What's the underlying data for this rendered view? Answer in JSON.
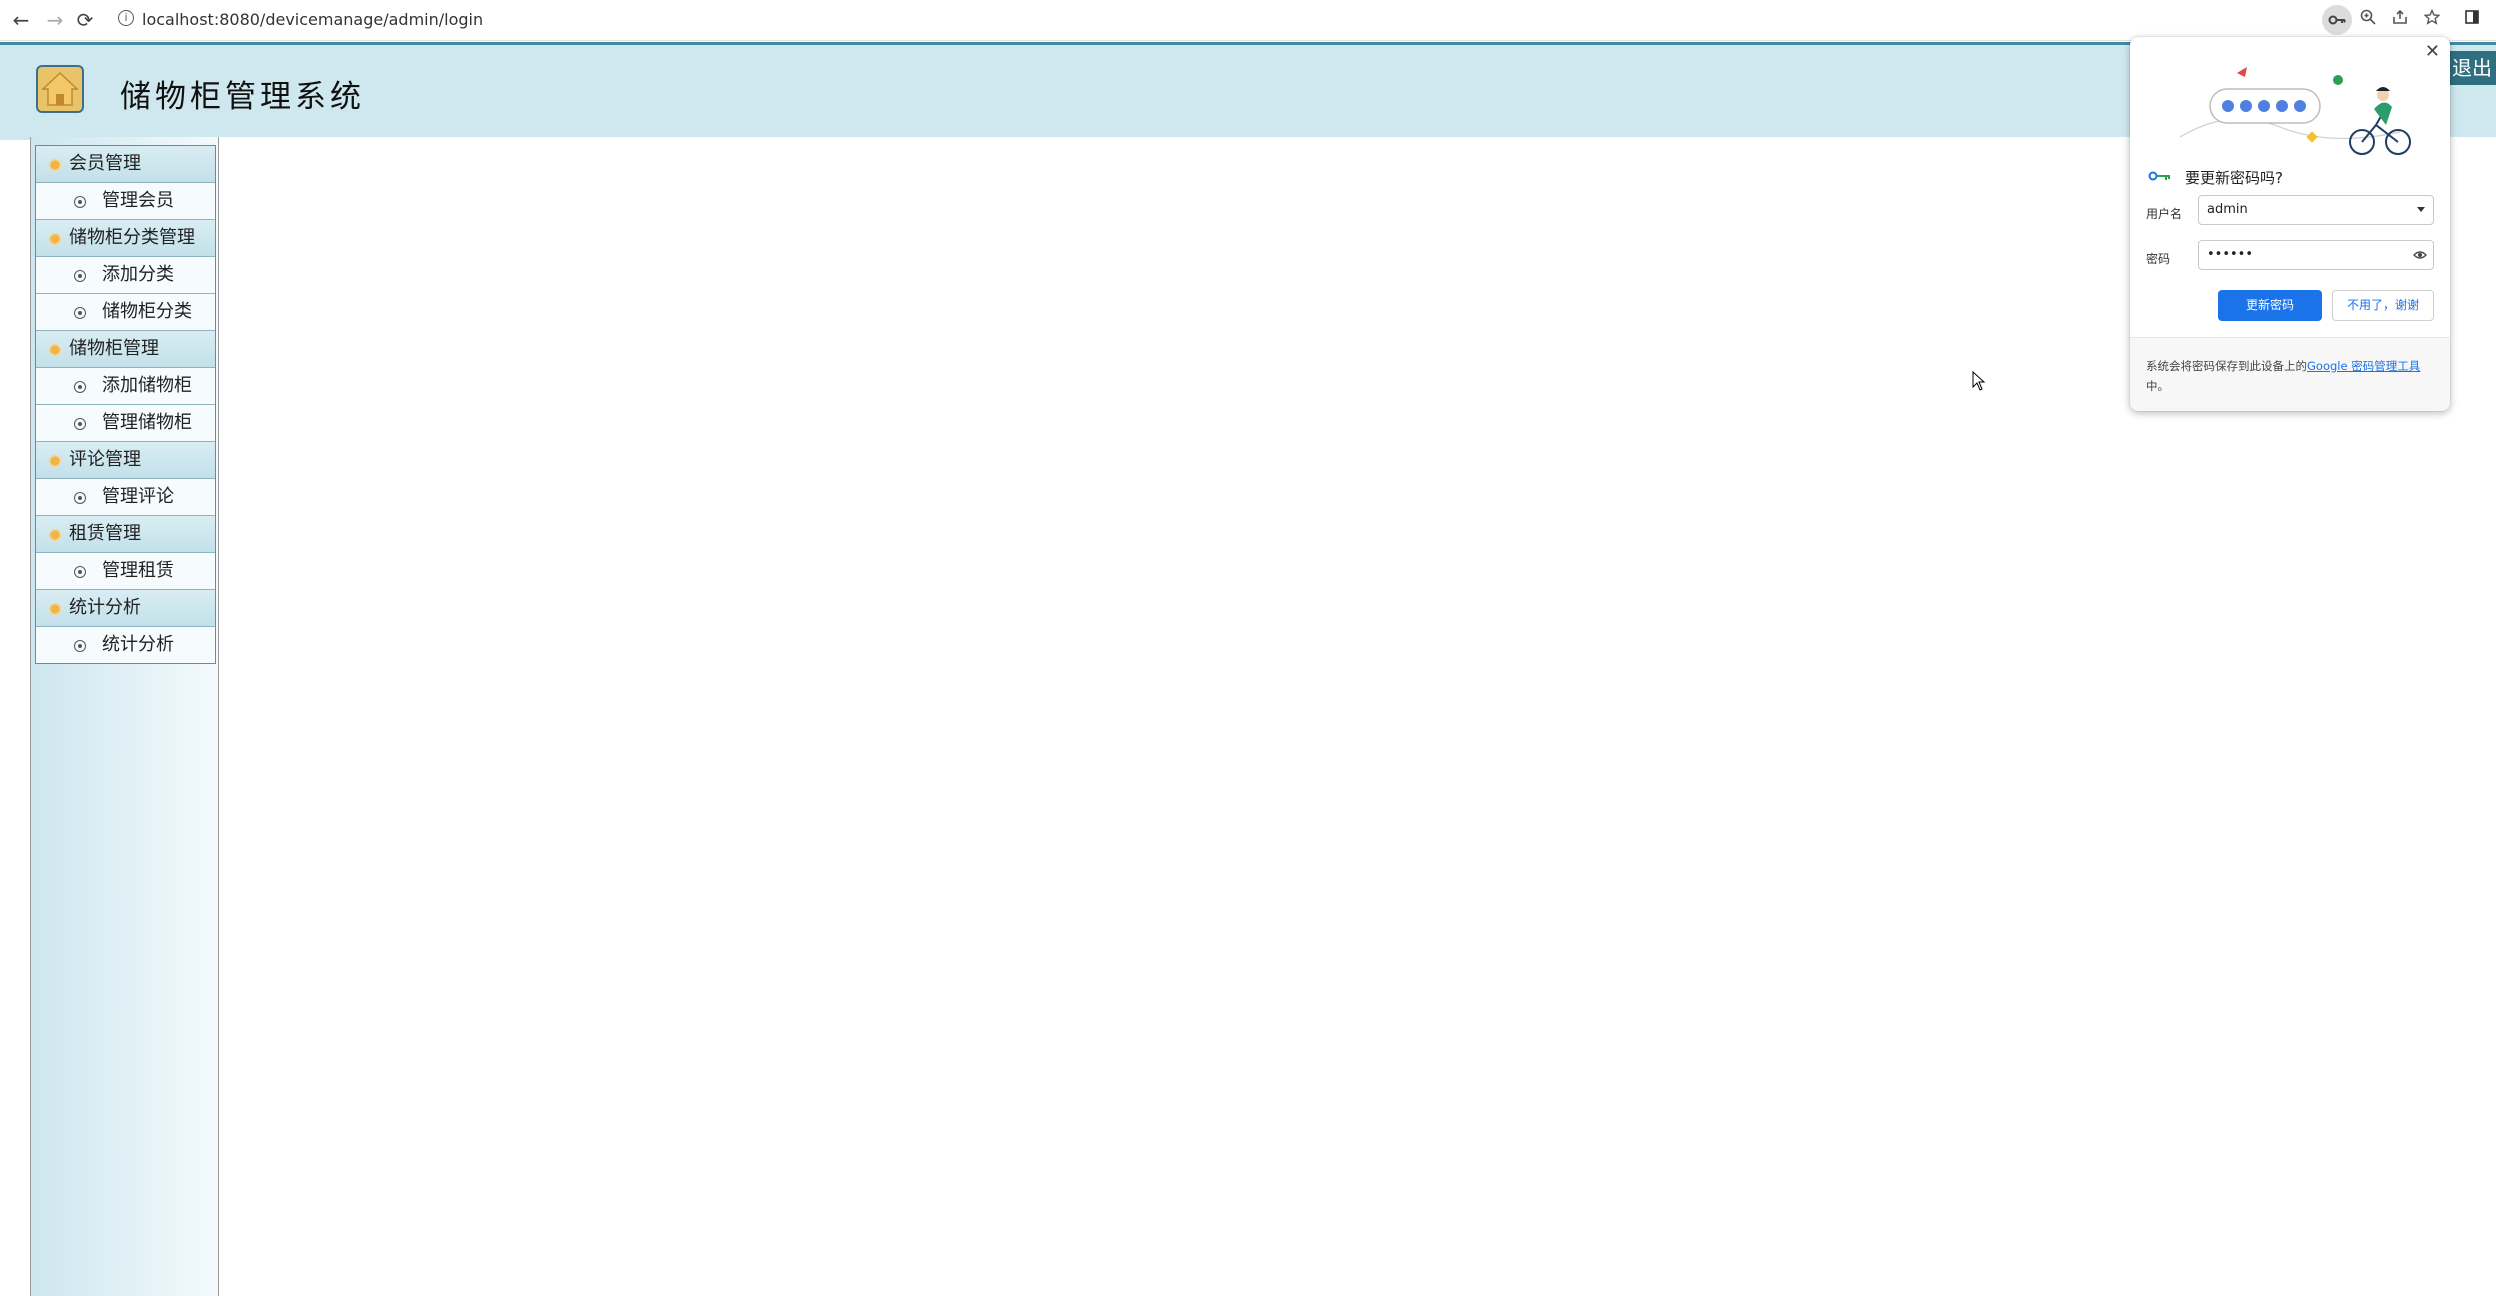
{
  "browser": {
    "url": "localhost:8080/devicemanage/admin/login",
    "back_icon": "←",
    "forward_icon": "→",
    "reload_icon": "⟳"
  },
  "header": {
    "title": "储物柜管理系统",
    "logout_label": "退出",
    "colors": {
      "header_bg": "#cfe8ef",
      "accent": "#3e8aa0"
    }
  },
  "sidebar": {
    "groups": [
      {
        "label": "会员管理",
        "items": [
          "管理会员"
        ]
      },
      {
        "label": "储物柜分类管理",
        "items": [
          "添加分类",
          "储物柜分类"
        ]
      },
      {
        "label": "储物柜管理",
        "items": [
          "添加储物柜",
          "管理储物柜"
        ]
      },
      {
        "label": "评论管理",
        "items": [
          "管理评论"
        ]
      },
      {
        "label": "租赁管理",
        "items": [
          "管理租赁"
        ]
      },
      {
        "label": "统计分析",
        "items": [
          "统计分析"
        ]
      }
    ]
  },
  "password_popup": {
    "title": "要更新密码吗?",
    "username_label": "用户名",
    "username_value": "admin",
    "password_label": "密码",
    "password_value": "••••••",
    "update_button": "更新密码",
    "dismiss_button": "不用了，谢谢",
    "footer_text": "系统会将密码保存到此设备上的",
    "footer_link": "Google 密码管理工具",
    "footer_suffix": "中。",
    "colors": {
      "primary": "#1a73e8"
    }
  }
}
